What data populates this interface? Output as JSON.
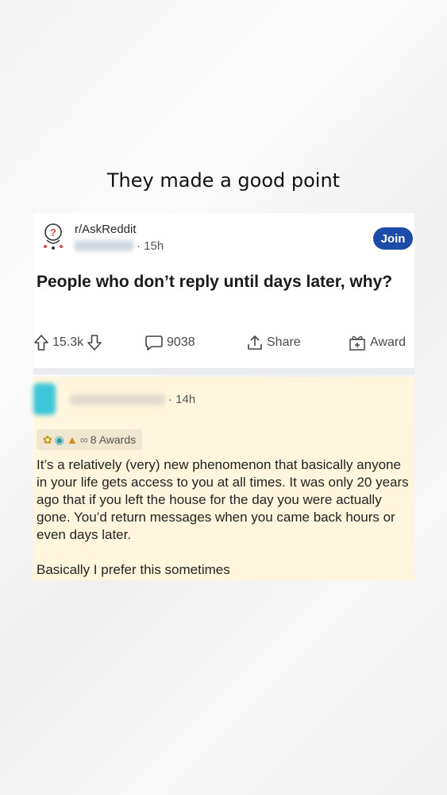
{
  "caption": "They made a good point",
  "post": {
    "subreddit": "r/AskReddit",
    "time": "· 15h",
    "join_label": "Join",
    "title": "People who don’t reply until days later, why?",
    "upvotes": "15.3k",
    "comments": "9038",
    "share_label": "Share",
    "award_label": "Award"
  },
  "comment": {
    "time": "· 14h",
    "awards_label": "8 Awards",
    "body": "It’s a relatively (very) new phenomenon that basically anyone in your life gets access to you at all times. It was only 20 years ago that if you left the house for the day you were actually gone. You’d return messages when you came back hours or even days later.",
    "body2": "Basically I prefer this sometimes"
  },
  "colors": {
    "join_bg": "#1a4ca8",
    "comment_bg": "#fff6dd",
    "avatar": "#3ec6d8"
  },
  "icons": [
    "askreddit-icon",
    "upvote-icon",
    "downvote-icon",
    "comment-icon",
    "share-icon",
    "award-icon"
  ]
}
